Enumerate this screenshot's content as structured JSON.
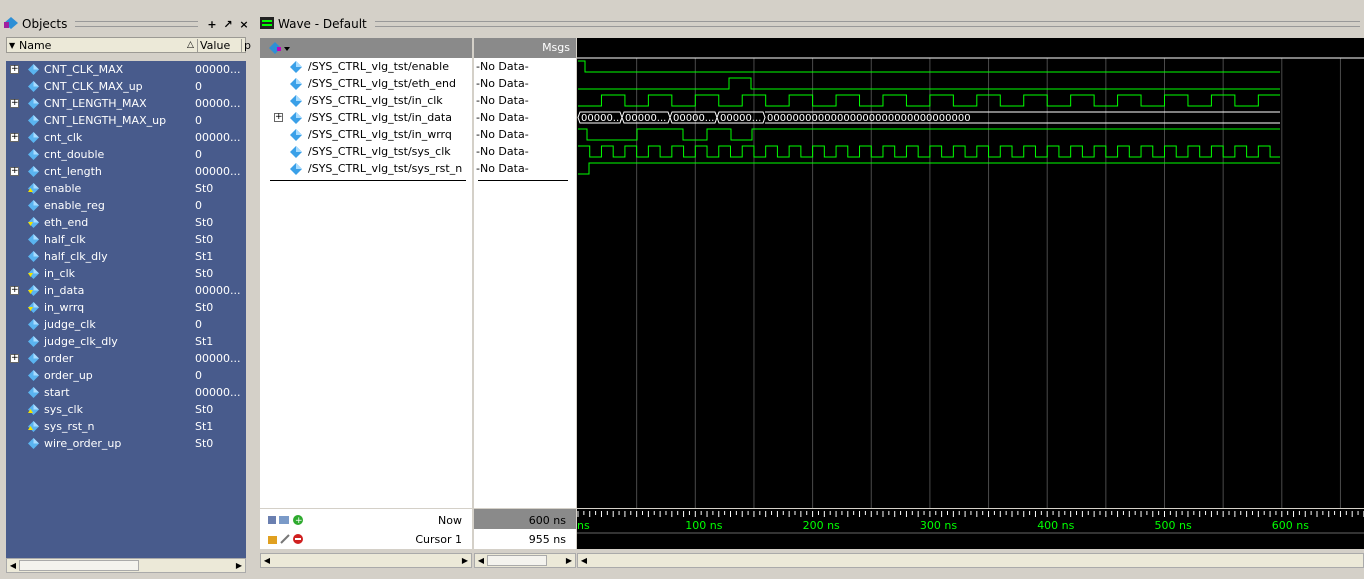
{
  "objects_panel": {
    "title": "Objects",
    "col_name": "Name",
    "col_value": "Value",
    "col_extra": "p",
    "items": [
      {
        "name": "CNT_CLK_MAX",
        "value": "00000...",
        "expandable": true,
        "icon": "param-icon"
      },
      {
        "name": "CNT_CLK_MAX_up",
        "value": "0",
        "expandable": false,
        "icon": "param-icon"
      },
      {
        "name": "CNT_LENGTH_MAX",
        "value": "00000...",
        "expandable": true,
        "icon": "param-icon"
      },
      {
        "name": "CNT_LENGTH_MAX_up",
        "value": "0",
        "expandable": false,
        "icon": "param-icon"
      },
      {
        "name": "cnt_clk",
        "value": "00000...",
        "expandable": true,
        "icon": "reg-icon"
      },
      {
        "name": "cnt_double",
        "value": "0",
        "expandable": false,
        "icon": "reg-icon"
      },
      {
        "name": "cnt_length",
        "value": "00000...",
        "expandable": true,
        "icon": "reg-icon"
      },
      {
        "name": "enable",
        "value": "St0",
        "expandable": false,
        "icon": "input-icon"
      },
      {
        "name": "enable_reg",
        "value": "0",
        "expandable": false,
        "icon": "reg-icon"
      },
      {
        "name": "eth_end",
        "value": "St0",
        "expandable": false,
        "icon": "output-icon"
      },
      {
        "name": "half_clk",
        "value": "St0",
        "expandable": false,
        "icon": "reg-icon"
      },
      {
        "name": "half_clk_dly",
        "value": "St1",
        "expandable": false,
        "icon": "reg-icon"
      },
      {
        "name": "in_clk",
        "value": "St0",
        "expandable": false,
        "icon": "output-icon"
      },
      {
        "name": "in_data",
        "value": "00000...",
        "expandable": true,
        "icon": "output-icon"
      },
      {
        "name": "in_wrrq",
        "value": "St0",
        "expandable": false,
        "icon": "output-icon"
      },
      {
        "name": "judge_clk",
        "value": "0",
        "expandable": false,
        "icon": "reg-icon"
      },
      {
        "name": "judge_clk_dly",
        "value": "St1",
        "expandable": false,
        "icon": "reg-icon"
      },
      {
        "name": "order",
        "value": "00000...",
        "expandable": true,
        "icon": "reg-icon"
      },
      {
        "name": "order_up",
        "value": "0",
        "expandable": false,
        "icon": "reg-icon"
      },
      {
        "name": "start",
        "value": "00000...",
        "expandable": false,
        "icon": "reg-icon"
      },
      {
        "name": "sys_clk",
        "value": "St0",
        "expandable": false,
        "icon": "input-icon"
      },
      {
        "name": "sys_rst_n",
        "value": "St1",
        "expandable": false,
        "icon": "input-icon"
      },
      {
        "name": "wire_order_up",
        "value": "St0",
        "expandable": false,
        "icon": "wire-icon"
      }
    ]
  },
  "wave_window": {
    "title": "Wave - Default",
    "msgs_header": "Msgs",
    "signals": [
      {
        "path": "/SYS_CTRL_vlg_tst/enable",
        "msg": "-No Data-",
        "expandable": false
      },
      {
        "path": "/SYS_CTRL_vlg_tst/eth_end",
        "msg": "-No Data-",
        "expandable": false
      },
      {
        "path": "/SYS_CTRL_vlg_tst/in_clk",
        "msg": "-No Data-",
        "expandable": false
      },
      {
        "path": "/SYS_CTRL_vlg_tst/in_data",
        "msg": "-No Data-",
        "expandable": true
      },
      {
        "path": "/SYS_CTRL_vlg_tst/in_wrrq",
        "msg": "-No Data-",
        "expandable": false
      },
      {
        "path": "/SYS_CTRL_vlg_tst/sys_clk",
        "msg": "-No Data-",
        "expandable": false
      },
      {
        "path": "/SYS_CTRL_vlg_tst/sys_rst_n",
        "msg": "-No Data-",
        "expandable": false
      }
    ],
    "bus_values": [
      "00000...",
      "00000...",
      "00000...",
      "00000...",
      "00000000000000000000000000000000"
    ],
    "now_label": "Now",
    "now_value": "600 ns",
    "cursor_label": "Cursor 1",
    "cursor_value": "955 ns",
    "timeline_labels": [
      "ns",
      "100 ns",
      "200 ns",
      "300 ns",
      "400 ns",
      "500 ns",
      "600 ns"
    ],
    "colors": {
      "wave": "#00ff00",
      "grid": "#4a4a4a",
      "objects_bg": "#485b8c"
    }
  }
}
